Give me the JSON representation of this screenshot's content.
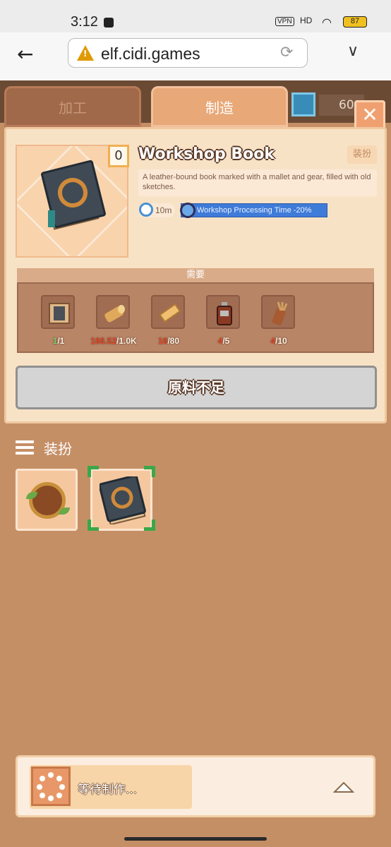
{
  "status_bar": {
    "time": "3:12",
    "vpn": "VPN",
    "signal": "HD",
    "battery": "87"
  },
  "browser": {
    "url": "elf.cidi.games",
    "warning_glyph": "!"
  },
  "tabs": [
    {
      "label": "加工",
      "active": false
    },
    {
      "label": "制造",
      "active": true
    }
  ],
  "currency": {
    "count": "60",
    "icon": "gem-icon"
  },
  "item": {
    "owned": "0",
    "name": "Workshop Book",
    "type_tag": "装扮",
    "description": "A leather-bound book marked with a mallet and gear, filled with old sketches.",
    "time": "10m",
    "buff": "Workshop Processing Time -20%"
  },
  "requirements": {
    "label": "需要",
    "materials": [
      {
        "icon": "blueprint-icon",
        "have": "1",
        "need": "/1",
        "enough": true
      },
      {
        "icon": "log-icon",
        "have": "166.52",
        "need": "/1.0K",
        "enough": false
      },
      {
        "icon": "plank-icon",
        "have": "16",
        "need": "/80",
        "enough": false
      },
      {
        "icon": "flask-icon",
        "have": "4",
        "need": "/5",
        "enough": false
      },
      {
        "icon": "quiver-icon",
        "have": "4",
        "need": "/10",
        "enough": false
      }
    ]
  },
  "action_button": {
    "label": "原料不足"
  },
  "skins": {
    "title": "装扮",
    "items": [
      {
        "icon": "shield-icon"
      },
      {
        "icon": "workshop-book-icon",
        "selected": true
      }
    ]
  },
  "queue": {
    "label": "等待制作..."
  },
  "colors": {
    "background": "#c58f66",
    "panel": "#f8e2c6",
    "active_tab": "#e8a878",
    "buff_blue": "#3f7bd8",
    "selection_green": "#3aa848"
  }
}
